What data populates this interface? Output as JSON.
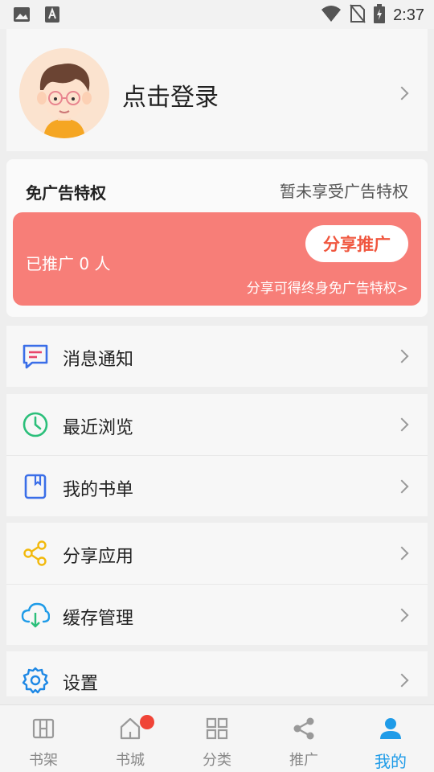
{
  "status_bar": {
    "time": "2:37",
    "icons": [
      "image-icon",
      "a-icon",
      "wifi-icon",
      "no-sim-icon",
      "battery-charging-icon"
    ]
  },
  "profile": {
    "login_label": "点击登录",
    "avatar_icon": "avatar-icon",
    "chevron_icon": "chevron-right-icon"
  },
  "ad_free": {
    "title": "免广告特权",
    "status": "暂未享受广告特权",
    "promoted_text": "已推广 0 人",
    "share_button": "分享推广",
    "share_desc": "分享可得终身免广告特权>",
    "banner_color": "#f77e78"
  },
  "menu": {
    "notifications": {
      "label": "消息通知",
      "icon": "message-icon",
      "color": "#3a6ee8"
    },
    "recent": {
      "label": "最近浏览",
      "icon": "clock-icon",
      "color": "#2bbf7a"
    },
    "booklist": {
      "label": "我的书单",
      "icon": "bookmark-icon",
      "color": "#3a6ee8"
    },
    "share_app": {
      "label": "分享应用",
      "icon": "share-icon",
      "color": "#f2b90c"
    },
    "cache": {
      "label": "缓存管理",
      "icon": "cloud-download-icon",
      "color": "#1e9be8"
    },
    "settings": {
      "label": "设置",
      "icon": "gear-icon",
      "color": "#1e88e5"
    }
  },
  "tabs": [
    {
      "label": "书架",
      "icon": "bookshelf-icon",
      "active": false
    },
    {
      "label": "书城",
      "icon": "home-icon",
      "active": false,
      "badge": true
    },
    {
      "label": "分类",
      "icon": "category-icon",
      "active": false
    },
    {
      "label": "推广",
      "icon": "share-icon",
      "active": false
    },
    {
      "label": "我的",
      "icon": "user-icon",
      "active": true
    }
  ],
  "colors": {
    "accent": "#1e9be8",
    "badge": "#f04437"
  }
}
